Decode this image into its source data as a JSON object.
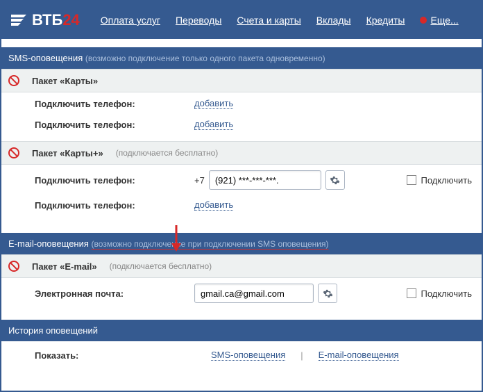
{
  "logo": {
    "text": "ВТБ",
    "suffix": "24"
  },
  "nav": {
    "pay": "Оплата услуг",
    "transfers": "Переводы",
    "accounts": "Счета и карты",
    "deposits": "Вклады",
    "credits": "Кредиты",
    "more": "Еще..."
  },
  "sms": {
    "title": "SMS-оповещения",
    "note": "(возможно подключение только одного пакета одновременно)",
    "pkg_cards": {
      "title": "Пакет «Карты»",
      "row1_label": "Подключить телефон:",
      "row1_link": "добавить",
      "row2_label": "Подключить телефон:",
      "row2_link": "добавить"
    },
    "pkg_cards_plus": {
      "title": "Пакет «Карты+»",
      "note": "(подключается бесплатно)",
      "row1_label": "Подключить телефон:",
      "prefix": "+7",
      "phone_value": "(921) ***-***-***.",
      "connect_label": "Подключить",
      "row2_label": "Подключить телефон:",
      "row2_link": "добавить"
    }
  },
  "email": {
    "title": "E-mail-оповещения",
    "note": "(возможно подключение при подключении SMS оповещения)",
    "pkg": {
      "title": "Пакет «E-mail»",
      "note": "(подключается бесплатно)",
      "row_label": "Электронная почта:",
      "email_value": "gmail.ca@gmail.com",
      "connect_label": "Подключить"
    }
  },
  "history": {
    "title": "История оповещений",
    "show_label": "Показать:",
    "link_sms": "SMS-оповещения",
    "link_email": "E-mail-оповещения"
  }
}
